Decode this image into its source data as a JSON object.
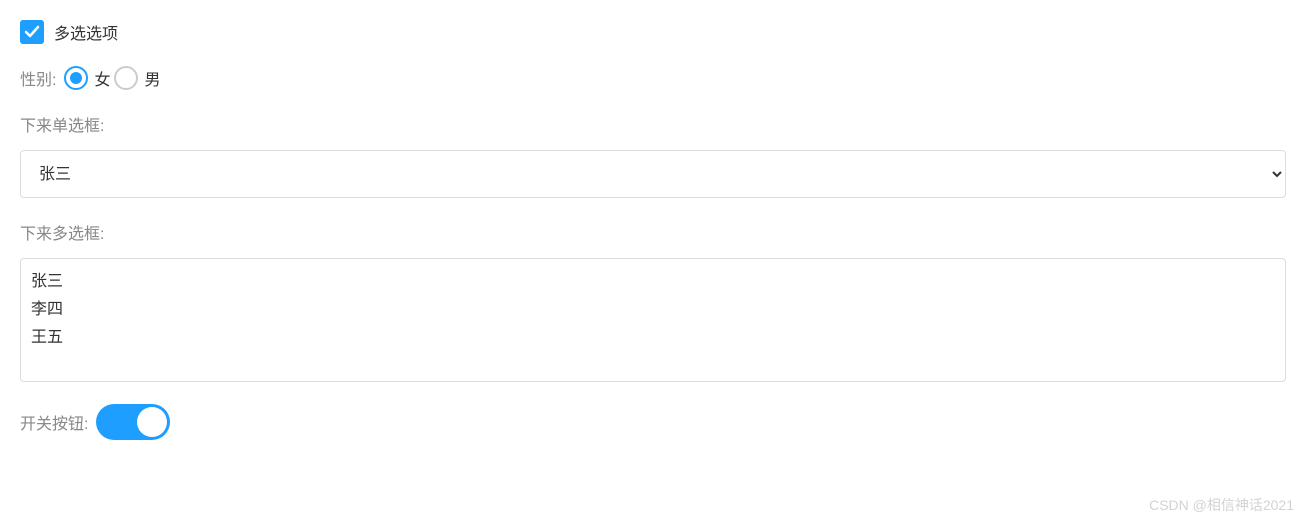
{
  "checkbox": {
    "label": "多选选项",
    "checked": true
  },
  "gender": {
    "label": "性别:",
    "options": [
      {
        "label": "女",
        "checked": true
      },
      {
        "label": "男",
        "checked": false
      }
    ]
  },
  "singleSelect": {
    "label": "下来单选框:",
    "selected": "张三",
    "options": [
      "张三"
    ]
  },
  "multiSelect": {
    "label": "下来多选框:",
    "options": [
      "张三",
      "李四",
      "王五"
    ]
  },
  "switch": {
    "label": "开关按钮:",
    "on": true
  },
  "watermark": "CSDN @相信神话2021"
}
